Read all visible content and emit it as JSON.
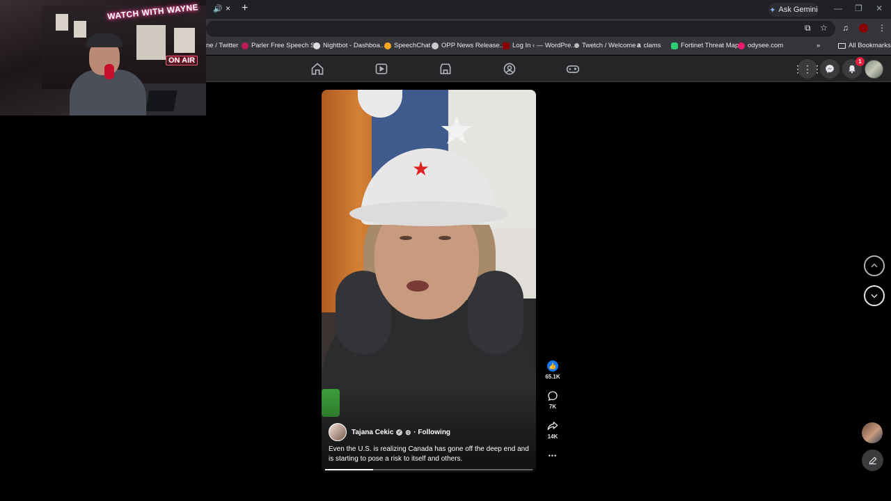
{
  "browser": {
    "gemini_label": "Ask Gemini",
    "tab_close": "×",
    "tab_new": "+",
    "win_min": "—",
    "win_max": "❐",
    "win_close": "✕",
    "bookmarks": [
      {
        "label": "ne / Twitter",
        "icon": "twitter-icon"
      },
      {
        "label": "Parler Free Speech S...",
        "icon": "parler-icon",
        "color": "#c2185b"
      },
      {
        "label": "Nightbot - Dashboa...",
        "icon": "nightbot-icon",
        "color": "#dddddd"
      },
      {
        "label": "SpeechChat",
        "icon": "speechchat-icon",
        "color": "#f5a623"
      },
      {
        "label": "OPP News Release...",
        "icon": "globe-icon",
        "color": "#cccccc"
      },
      {
        "label": "Log In ‹ — WordPre...",
        "icon": "wordpress-icon",
        "color": "#8b0000"
      },
      {
        "label": "Twetch / Welcome",
        "icon": "twetch-icon",
        "color": "#bbbbbb"
      },
      {
        "label": "clams",
        "icon": "amazon-icon",
        "color": "#ffffff"
      },
      {
        "label": "Fortinet Threat Map",
        "icon": "fortinet-icon",
        "color": "#2ecc71"
      },
      {
        "label": "odysee.com",
        "icon": "odysee-icon",
        "color": "#ef1970"
      }
    ],
    "bookmarks_overflow": "»",
    "all_bookmarks": "All Bookmarks"
  },
  "webcam": {
    "sign": "WATCH WITH WAYNE",
    "on_air": "ON AIR"
  },
  "facebook": {
    "notification_count": "1"
  },
  "reel": {
    "author": "Tajana Cekic",
    "following_label": "· Following",
    "caption": "Even the U.S. is realizing Canada has gone off the deep end and is starting to pose a risk to itself and others.",
    "progress": 0.23,
    "likes": "65.1K",
    "comments": "7K",
    "shares": "14K",
    "more": "•••"
  },
  "colors": {
    "accent": "#1877f2",
    "badge": "#e41e3f"
  }
}
